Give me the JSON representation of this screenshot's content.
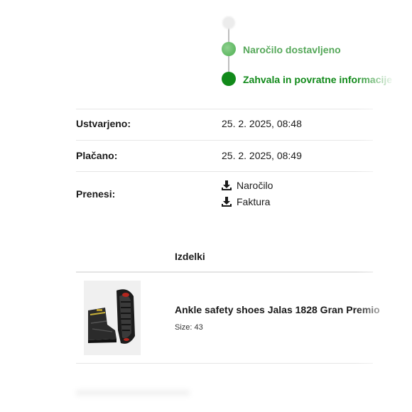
{
  "timeline": {
    "steps": [
      {
        "label": "Naročilo dostavljeno",
        "color": "#56a85a"
      },
      {
        "label": "Zahvala in povratne informacije",
        "color": "#118a1a"
      }
    ]
  },
  "details": {
    "created_label": "Ustvarjeno:",
    "created_value": "25. 2. 2025, 08:48",
    "paid_label": "Plačano:",
    "paid_value": "25. 2. 2025, 08:49",
    "download_label": "Prenesi:",
    "downloads": [
      "Naročilo",
      "Faktura"
    ]
  },
  "products": {
    "header": "Izdelki",
    "items": [
      {
        "name": "Ankle safety shoes Jalas 1828 Gran Premio",
        "size": "Size: 43"
      }
    ]
  },
  "icons": {
    "download": "download-icon",
    "product_image": "safety-boots-image"
  }
}
